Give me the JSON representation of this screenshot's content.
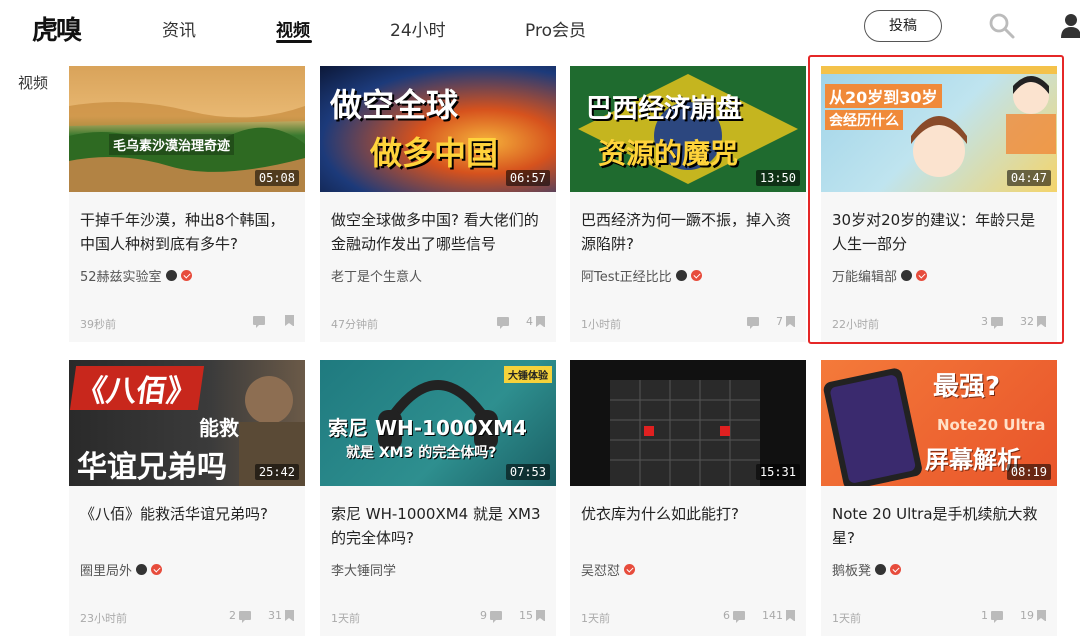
{
  "header": {
    "logo": "虎嗅",
    "nav": [
      "资讯",
      "视频",
      "24小时",
      "Pro会员"
    ],
    "active_nav": "视频",
    "submit_label": "投稿",
    "icons": [
      "search-icon",
      "user-icon"
    ]
  },
  "sidebar": {
    "label": "视频"
  },
  "videos": [
    {
      "thumb_text": "毛乌素沙漠治理奇迹",
      "duration": "05:08",
      "title": "干掉千年沙漠，种出8个韩国，中国人种树到底有多牛?",
      "author": "52赫兹实验室",
      "time": "39秒前",
      "comments": "",
      "saves": ""
    },
    {
      "thumb_text_1": "做空全球",
      "thumb_text_2": "做多中国",
      "duration": "06:57",
      "title": "做空全球做多中国? 看大佬们的金融动作发出了哪些信号",
      "author": "老丁是个生意人",
      "time": "47分钟前",
      "comments": "",
      "saves": "4"
    },
    {
      "thumb_text_1": "巴西经济崩盘",
      "thumb_text_2": "资源的魔咒",
      "duration": "13:50",
      "title": "巴西经济为何一蹶不振，掉入资源陷阱?",
      "author": "阿Test正经比比",
      "time": "1小时前",
      "comments": "",
      "saves": "7"
    },
    {
      "thumb_text_1": "从20岁到30岁",
      "thumb_text_2": "会经历什么",
      "duration": "04:47",
      "title": "30岁对20岁的建议：年龄只是人生一部分",
      "author": "万能编辑部",
      "time": "22小时前",
      "comments": "3",
      "saves": "32"
    },
    {
      "thumb_text_1": "《八佰》",
      "thumb_text_2": "能救",
      "thumb_text_3": "华谊兄弟吗",
      "duration": "25:42",
      "title": "《八佰》能救活华谊兄弟吗?",
      "author": "圈里局外",
      "time": "23小时前",
      "comments": "2",
      "saves": "31"
    },
    {
      "thumb_tag": "大锤体验",
      "thumb_text_1": "索尼 WH-1000XM4",
      "thumb_text_2": "就是 XM3 的完全体吗?",
      "duration": "07:53",
      "title": "索尼 WH-1000XM4 就是 XM3 的完全体吗?",
      "author": "李大锤同学",
      "time": "1天前",
      "comments": "9",
      "saves": "15"
    },
    {
      "duration": "15:31",
      "title": "优衣库为什么如此能打?",
      "author": "吴怼怼",
      "time": "1天前",
      "comments": "6",
      "saves": "141"
    },
    {
      "thumb_text_1": "最强?",
      "thumb_text_2": "Note20 Ultra",
      "thumb_text_3": "屏幕解析",
      "duration": "08:19",
      "title": "Note 20 Ultra是手机续航大救星?",
      "author": "鹅板凳",
      "time": "1天前",
      "comments": "1",
      "saves": "19"
    }
  ],
  "colors": {
    "highlight": "#e52727",
    "badge_red": "#e74c3c",
    "card_bg": "#f7f7f7"
  }
}
